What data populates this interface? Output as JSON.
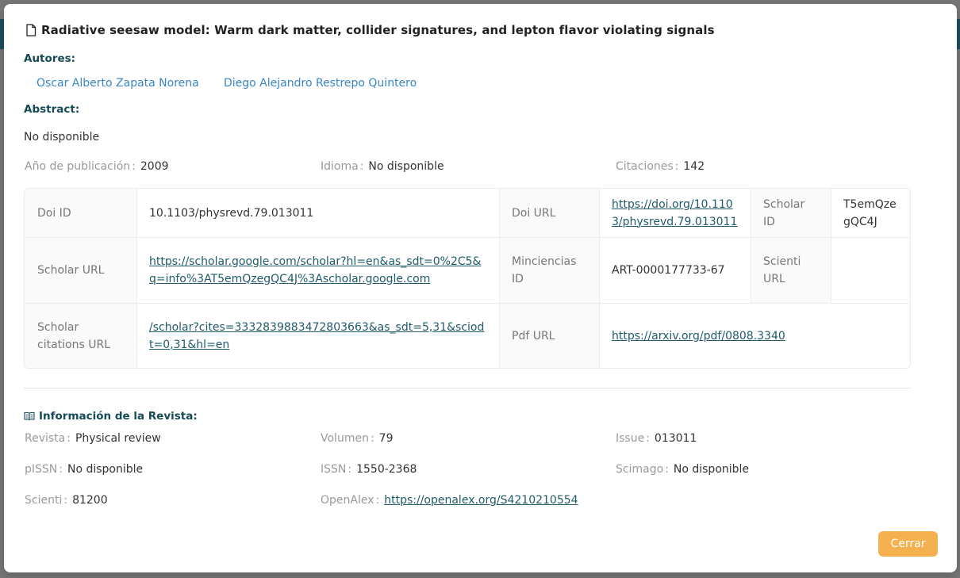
{
  "modal": {
    "title": "Radiative seesaw model: Warm dark matter, collider signatures, and lepton flavor violating signals",
    "authors_label": "Autores:",
    "authors": [
      "Oscar Alberto Zapata Norena",
      "Diego Alejandro Restrepo Quintero"
    ],
    "abstract_label": "Abstract:",
    "abstract_text": "No disponible",
    "year_label": "Año de publicación",
    "year": "2009",
    "language_label": "Idioma",
    "language": "No disponible",
    "citations_label": "Citaciones",
    "citations": "142",
    "close_label": "Cerrar"
  },
  "table": {
    "doi_id_label": "Doi ID",
    "doi_id": "10.1103/physrevd.79.013011",
    "doi_url_label": "Doi URL",
    "doi_url": "https://doi.org/10.1103/physrevd.79.013011",
    "scholar_id_label": "Scholar ID",
    "scholar_id": "T5emQzegQC4J",
    "scholar_url_label": "Scholar URL",
    "scholar_url": "https://scholar.google.com/scholar?hl=en&as_sdt=0%2C5&q=info%3AT5emQzegQC4J%3Ascholar.google.com",
    "minciencias_id_label": "Minciencias ID",
    "minciencias_id": "ART-0000177733-67",
    "scienti_url_label": "Scienti URL",
    "scienti_url": "",
    "citations_url_label": "Scholar citations URL",
    "citations_url": "/scholar?cites=3332839883472803663&as_sdt=5,31&sciodt=0,31&hl=en",
    "pdf_url_label": "Pdf URL",
    "pdf_url": "https://arxiv.org/pdf/0808.3340"
  },
  "journal": {
    "section_label": "Información de la Revista:",
    "revista_label": "Revista",
    "revista": "Physical review",
    "volumen_label": "Volumen",
    "volumen": "79",
    "issue_label": "Issue",
    "issue": "013011",
    "pissn_label": "pISSN",
    "pissn": "No disponible",
    "issn_label": "ISSN",
    "issn": "1550-2368",
    "scimago_label": "Scimago",
    "scimago": "No disponible",
    "scienti_label": "Scienti",
    "scienti": "81200",
    "openalex_label": "OpenAlex",
    "openalex": "https://openalex.org/S4210210554"
  },
  "colors": {
    "accent": "#154a57",
    "link": "#3a86c6",
    "button": "#f5b14f"
  },
  "icons": {
    "title_icon": "document-icon",
    "journal_icon": "book-open-icon"
  }
}
